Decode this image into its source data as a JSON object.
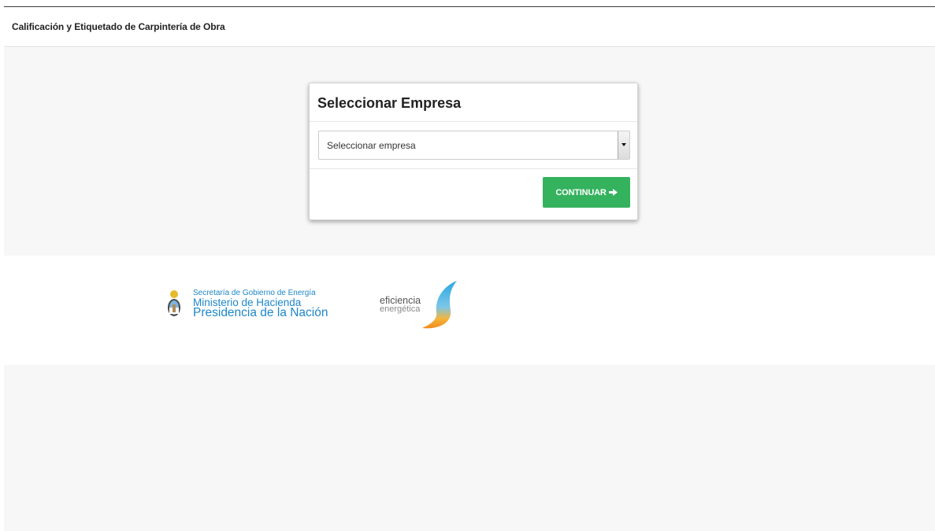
{
  "header": {
    "title": "Calificación y Etiquetado de Carpintería de Obra"
  },
  "card": {
    "title": "Seleccionar Empresa",
    "select": {
      "value": "Seleccionar empresa",
      "icon": "select-arrow-icon"
    },
    "button": {
      "label": "CONTINUAR",
      "icon": "arrow-right-icon",
      "color": "#34b25e"
    }
  },
  "logos": {
    "secretaria": {
      "line1": "Secretaría de Gobierno de Energía",
      "line2": "Ministerio de Hacienda",
      "line3": "Presidencia de la Nación",
      "color": "#1e87c8",
      "icon": "argentina-coat-of-arms-icon"
    },
    "eficiencia": {
      "word1": "eficiencia",
      "word2": "energética",
      "icon": "energy-drop-icon"
    }
  }
}
